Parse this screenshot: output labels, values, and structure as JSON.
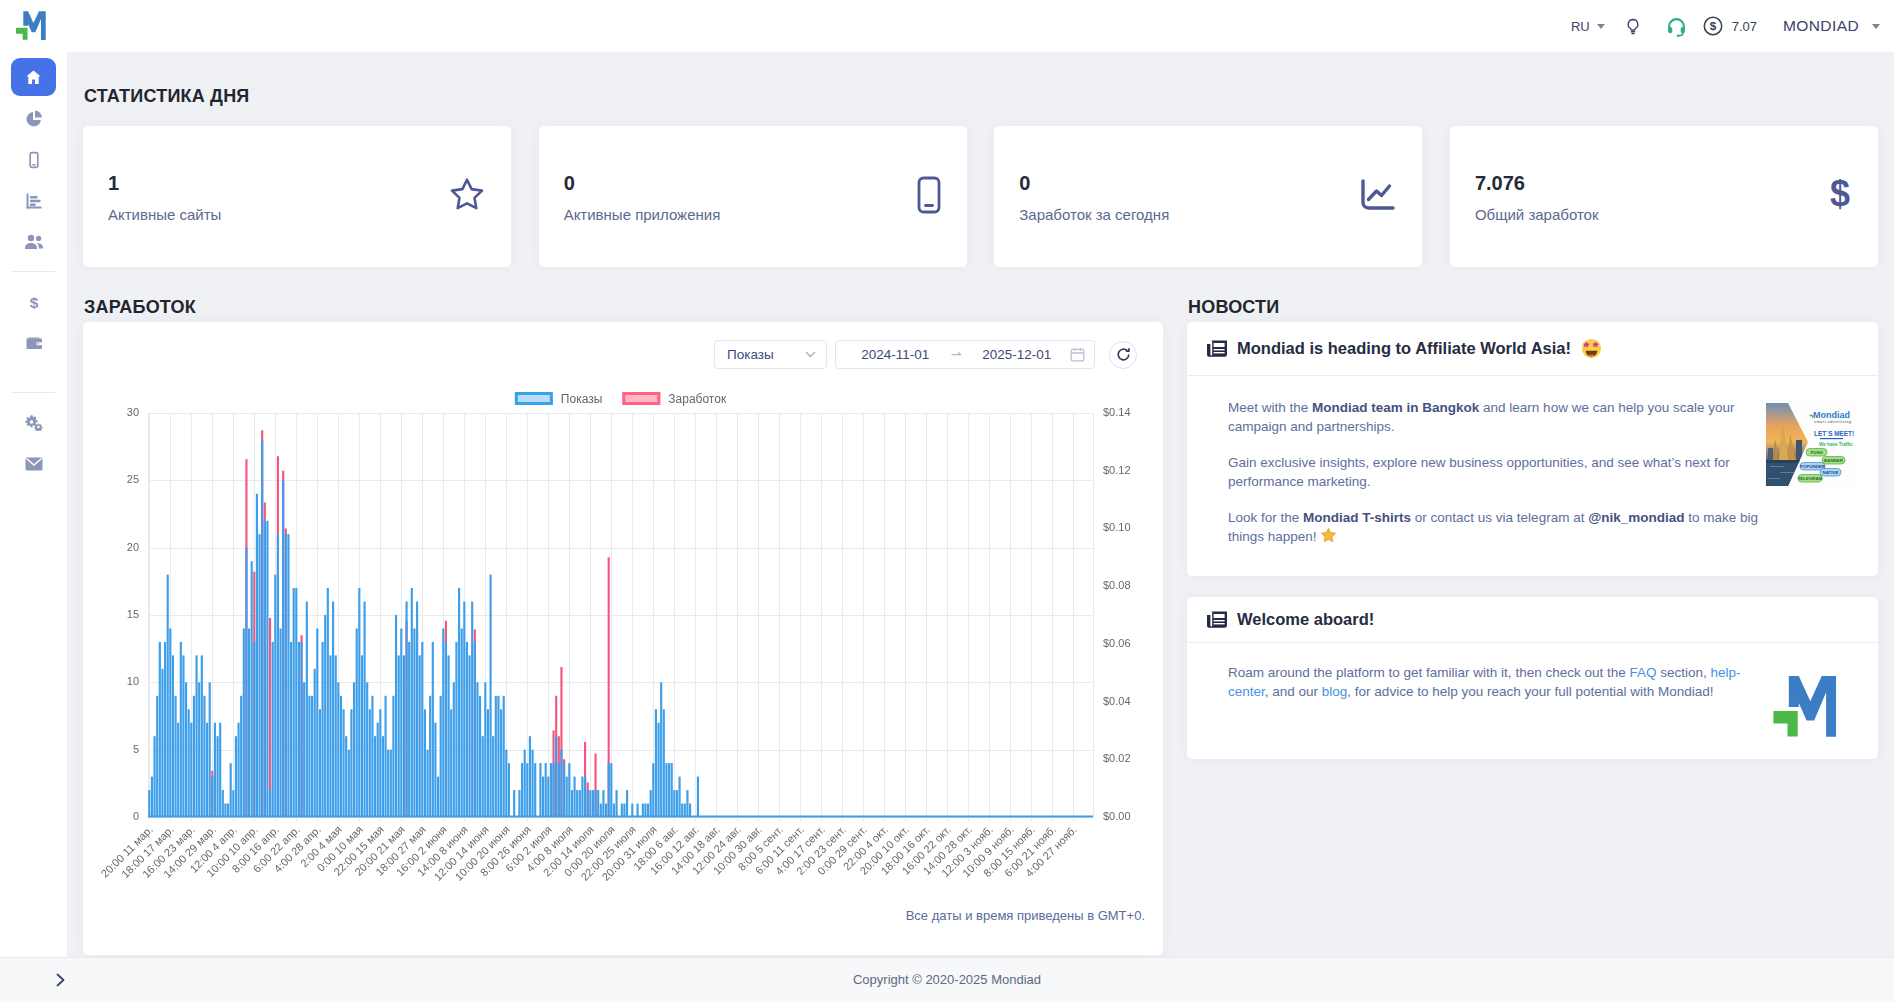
{
  "header": {
    "language": "RU",
    "balance": "7.07",
    "account_name": "MONDIAD"
  },
  "sidebar": {
    "items": [
      {
        "icon": "home",
        "active": true
      },
      {
        "icon": "pie-chart",
        "active": false
      },
      {
        "icon": "mobile",
        "active": false
      },
      {
        "icon": "bar-chart",
        "active": false
      },
      {
        "icon": "users",
        "active": false
      },
      {
        "icon": "dollar",
        "active": false
      },
      {
        "icon": "wallet",
        "active": false
      },
      {
        "icon": "gears",
        "active": false
      },
      {
        "icon": "envelope",
        "active": false
      }
    ],
    "collapse_icon": "chevron-right"
  },
  "stats": {
    "title": "СТАТИСТИКА ДНЯ",
    "cards": [
      {
        "value": "1",
        "label": "Активные сайты",
        "icon": "star"
      },
      {
        "value": "0",
        "label": "Активные приложения",
        "icon": "mobile"
      },
      {
        "value": "0",
        "label": "Заработок за сегодня",
        "icon": "chart-line"
      },
      {
        "value": "7.076",
        "label": "Общий заработок",
        "icon": "dollar"
      }
    ]
  },
  "earnings": {
    "title": "ЗАРАБОТОК",
    "metric_select": "Показы",
    "date_from": "2024-11-01",
    "date_to": "2025-12-01",
    "timezone_note": "Все даты и время приведены в GMT+0.",
    "chart_data": {
      "type": "bar",
      "x_tick_labels": [
        "20:00 11 мар.",
        "18:00 17 мар.",
        "16:00 23 мар.",
        "14:00 29 мар.",
        "12:00 4 апр.",
        "10:00 10 апр.",
        "8:00 16 апр.",
        "6:00 22 апр.",
        "4:00 28 апр.",
        "2:00 4 мая",
        "0:00 10 мая",
        "22:00 15 мая",
        "20:00 21 мая",
        "18:00 27 мая",
        "16:00 2 июня",
        "14:00 8 июня",
        "12:00 14 июня",
        "10:00 20 июня",
        "8:00 26 июня",
        "6:00 2 июля",
        "4:00 8 июля",
        "2:00 14 июля",
        "0:00 20 июля",
        "22:00 25 июля",
        "20:00 31 июля",
        "18:00 6 авг.",
        "16:00 12 авг.",
        "14:00 18 авг.",
        "12:00 24 авг.",
        "10:00 30 авг.",
        "8:00 5 сент.",
        "6:00 11 сент.",
        "4:00 17 сент.",
        "2:00 23 сент.",
        "0:00 29 сент.",
        "22:00 4 окт.",
        "20:00 10 окт.",
        "18:00 16 окт.",
        "16:00 22 окт.",
        "14:00 28 окт.",
        "12:00 3 нояб.",
        "10:00 9 нояб.",
        "8:00 15 нояб.",
        "6:00 21 нояб.",
        "4:00 27 нояб."
      ],
      "ticks_every": 8,
      "series": [
        {
          "name": "Показы",
          "axis": "left",
          "color": "#3d9ee9",
          "legend_fill": "#b9dcf7",
          "legend_border": "#36a2eb",
          "values": [
            2,
            3,
            6,
            9,
            13,
            11,
            13,
            18,
            14,
            12,
            9,
            7,
            13,
            12,
            10,
            8,
            7,
            9,
            12,
            10,
            12,
            9,
            7,
            10,
            3,
            7,
            6,
            7,
            2,
            1,
            1,
            4,
            2,
            6,
            7,
            9,
            14,
            20,
            14,
            19,
            13,
            24,
            21,
            28,
            22,
            22,
            2,
            13,
            18,
            21,
            14,
            25,
            21,
            21,
            13,
            17,
            17,
            13,
            13,
            10,
            16,
            9,
            9,
            11,
            14,
            8,
            13,
            15,
            17,
            12,
            16,
            12,
            10,
            9,
            8,
            6,
            5,
            8,
            10,
            14,
            17,
            12,
            16,
            10,
            8,
            9,
            6,
            7,
            8,
            6,
            9,
            5,
            5,
            9,
            15,
            12,
            14,
            12,
            16,
            13,
            17,
            14,
            16,
            12,
            13,
            8,
            5,
            9,
            13,
            7,
            3,
            9,
            14,
            13,
            12,
            8,
            10,
            13,
            17,
            14,
            16,
            13,
            12,
            16,
            13,
            10,
            9,
            6,
            10,
            8,
            18,
            6,
            9,
            9,
            8,
            9,
            5,
            4,
            0,
            2,
            0,
            2,
            4,
            5,
            4,
            6,
            5,
            4,
            0,
            4,
            3,
            4,
            3,
            4,
            4,
            6,
            4,
            5,
            4,
            3,
            4,
            2,
            3,
            2,
            2,
            3,
            3,
            2,
            2,
            2,
            2,
            2,
            1,
            2,
            1,
            4,
            4,
            1,
            2,
            0,
            1,
            1,
            2,
            0,
            1,
            0,
            1,
            0,
            1,
            1,
            1,
            2,
            4,
            8,
            7,
            10,
            8,
            4,
            4,
            4,
            2,
            2,
            3,
            1,
            1,
            2,
            1,
            0,
            0,
            3,
            0,
            0,
            0,
            0,
            0,
            0,
            0,
            0,
            0,
            0,
            0,
            0,
            0,
            0,
            0,
            0,
            0,
            0,
            0,
            0,
            0,
            0,
            0,
            0,
            0,
            0,
            0,
            0,
            0,
            0,
            0,
            0,
            0,
            0,
            0,
            0,
            0,
            0,
            0,
            0,
            0,
            0,
            0,
            0,
            0,
            0,
            0,
            0,
            0,
            0,
            0,
            0,
            0,
            0,
            0,
            0,
            0,
            0,
            0,
            0,
            0,
            0,
            0,
            0,
            0,
            0,
            0,
            0,
            0,
            0,
            0,
            0,
            0,
            0,
            0,
            0,
            0,
            0,
            0,
            0,
            0,
            0,
            0,
            0,
            0,
            0,
            0,
            0,
            0,
            0,
            0,
            0,
            0,
            0,
            0,
            0,
            0,
            0,
            0,
            0,
            0,
            0,
            0,
            0,
            0,
            0,
            0,
            0,
            0,
            0,
            0,
            0,
            0,
            0,
            0,
            0,
            0,
            0,
            0,
            0,
            0,
            0,
            0,
            0,
            0,
            0,
            0,
            0,
            0,
            0,
            0,
            0,
            0,
            0,
            0,
            0,
            0,
            0,
            0,
            0,
            0,
            0,
            0,
            0,
            0,
            0,
            0,
            0,
            0,
            0
          ]
        },
        {
          "name": "Заработок",
          "axis": "right",
          "color": "#f4577d",
          "legend_fill": "#ffb6c5",
          "legend_border": "#ff6384",
          "values": [
            0,
            0,
            0,
            0,
            0,
            0,
            0,
            0,
            0,
            0,
            0,
            0,
            0,
            0,
            0,
            0,
            0,
            0,
            0,
            0,
            0,
            0,
            0,
            0,
            0.016,
            0,
            0,
            0,
            0,
            0,
            0,
            0,
            0,
            0,
            0,
            0,
            0,
            0.124,
            0,
            0,
            0.085,
            0,
            0,
            0.134,
            0.109,
            0,
            0.069,
            0,
            0,
            0.125,
            0,
            0.12,
            0.1,
            0,
            0,
            0,
            0,
            0,
            0.063,
            0,
            0,
            0,
            0,
            0,
            0,
            0,
            0,
            0,
            0,
            0,
            0,
            0,
            0,
            0,
            0,
            0,
            0,
            0,
            0,
            0,
            0,
            0,
            0,
            0,
            0,
            0,
            0,
            0,
            0,
            0,
            0,
            0,
            0,
            0,
            0,
            0,
            0,
            0,
            0.068,
            0,
            0,
            0,
            0.065,
            0,
            0,
            0,
            0,
            0,
            0,
            0,
            0,
            0,
            0,
            0.068,
            0,
            0,
            0,
            0,
            0,
            0,
            0,
            0,
            0,
            0,
            0.065,
            0,
            0,
            0,
            0,
            0,
            0,
            0,
            0,
            0,
            0,
            0,
            0,
            0,
            0,
            0,
            0,
            0,
            0,
            0,
            0,
            0,
            0,
            0,
            0,
            0,
            0,
            0,
            0,
            0,
            0.03,
            0.042,
            0.028,
            0.052,
            0.02,
            0,
            0,
            0,
            0,
            0,
            0,
            0,
            0.026,
            0.012,
            0,
            0.008,
            0.022,
            0,
            0,
            0,
            0,
            0.09,
            0,
            0,
            0,
            0,
            0,
            0,
            0,
            0,
            0,
            0,
            0,
            0,
            0,
            0,
            0,
            0,
            0,
            0,
            0,
            0,
            0,
            0,
            0,
            0,
            0,
            0,
            0,
            0,
            0,
            0,
            0,
            0,
            0,
            0,
            0,
            0,
            0,
            0,
            0,
            0,
            0,
            0,
            0,
            0,
            0,
            0,
            0,
            0,
            0,
            0,
            0,
            0,
            0,
            0,
            0,
            0,
            0,
            0,
            0,
            0,
            0,
            0,
            0,
            0,
            0,
            0,
            0,
            0,
            0,
            0,
            0,
            0,
            0,
            0,
            0,
            0,
            0,
            0,
            0,
            0,
            0,
            0,
            0,
            0,
            0,
            0,
            0,
            0,
            0,
            0,
            0,
            0,
            0,
            0,
            0,
            0,
            0,
            0,
            0,
            0,
            0,
            0,
            0,
            0,
            0,
            0,
            0,
            0,
            0,
            0,
            0,
            0,
            0,
            0,
            0,
            0,
            0,
            0,
            0,
            0,
            0,
            0,
            0,
            0,
            0,
            0,
            0,
            0,
            0,
            0,
            0,
            0,
            0,
            0,
            0,
            0,
            0,
            0,
            0,
            0,
            0,
            0,
            0,
            0,
            0,
            0,
            0,
            0,
            0,
            0,
            0,
            0,
            0,
            0,
            0,
            0,
            0,
            0,
            0,
            0,
            0,
            0,
            0,
            0,
            0,
            0,
            0,
            0,
            0,
            0,
            0,
            0,
            0,
            0,
            0,
            0,
            0,
            0,
            0,
            0,
            0,
            0,
            0,
            0
          ]
        }
      ],
      "y_left": {
        "min": 0,
        "max": 30,
        "ticks": [
          0,
          5,
          10,
          15,
          20,
          25,
          30
        ]
      },
      "y_right": {
        "min": 0,
        "max": 0.14,
        "tick_labels": [
          "$0.00",
          "$0.02",
          "$0.04",
          "$0.06",
          "$0.08",
          "$0.10",
          "$0.12",
          "$0.14"
        ]
      },
      "grid": true,
      "legend_position": "top"
    }
  },
  "news": {
    "title": "НОВОСТИ",
    "items": [
      {
        "title": "Mondiad is heading to Affiliate World Asia!",
        "title_emoji": "star-struck-emoji",
        "paragraphs": [
          [
            [
              "t",
              "Meet with the "
            ],
            [
              "b",
              "Mondiad team in Bangkok"
            ],
            [
              "t",
              " and learn how we can help you scale your campaign and partnerships."
            ]
          ],
          [
            [
              "t",
              "Gain exclusive insights, explore new business opportunities, and see what’s next for performance marketing."
            ]
          ],
          [
            [
              "t",
              "Look for the "
            ],
            [
              "b",
              "Mondiad T-shirts"
            ],
            [
              "t",
              " or contact us via telegram at "
            ],
            [
              "b",
              "@nik_mondiad"
            ],
            [
              "t",
              " to make big things happen! "
            ],
            [
              "star",
              ""
            ]
          ]
        ],
        "image": "affiliate-world-asia-banner",
        "banner": {
          "brand": "Mondiad",
          "tagline": "smart advertising",
          "headline": "LET`S MEET!",
          "subline": "We have Traffic",
          "pills": [
            {
              "label": "PUSH",
              "color": "green"
            },
            {
              "label": "BANNER",
              "color": "green"
            },
            {
              "label": "POPUNDER",
              "color": "blue"
            },
            {
              "label": "NATIVE",
              "color": "blue"
            },
            {
              "label": "TELEGRAM",
              "color": "green"
            }
          ]
        }
      },
      {
        "title": "Welcome aboard!",
        "title_emoji": null,
        "paragraphs": [
          [
            [
              "t",
              "Roam around the platform to get familiar with it, then check out the "
            ],
            [
              "l",
              "FAQ"
            ],
            [
              "t",
              " section, "
            ],
            [
              "l",
              "help-center"
            ],
            [
              "t",
              ", and our "
            ],
            [
              "l",
              "blog"
            ],
            [
              "t",
              ", for advice to help you reach your full potential with Mondiad!"
            ]
          ]
        ],
        "image": "mondiad-logo"
      }
    ]
  },
  "footer": {
    "copyright": "Copyright © 2020-2025 Mondiad"
  }
}
